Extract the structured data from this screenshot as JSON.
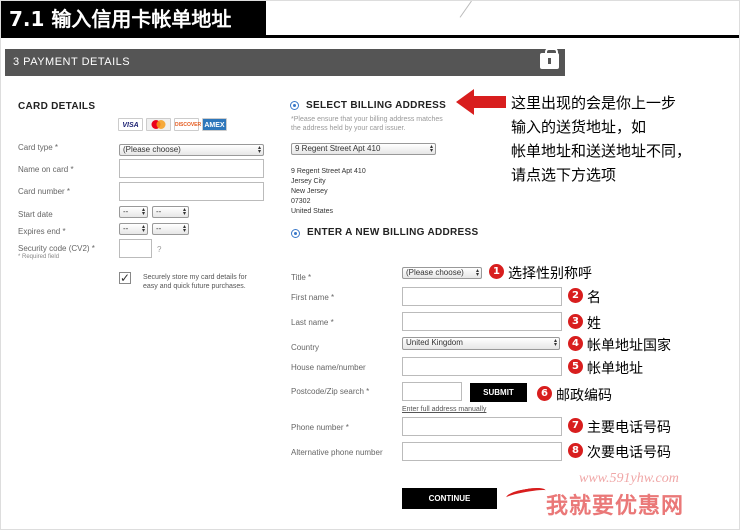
{
  "page": {
    "title": "7.1 输入信用卡帐单地址",
    "section": "3 PAYMENT DETAILS"
  },
  "card": {
    "heading": "CARD DETAILS",
    "logos": [
      "VISA",
      "MC",
      "DISCOVER",
      "AMEX"
    ],
    "type_label": "Card type *",
    "type_value": "(Please choose)",
    "name_label": "Name on card *",
    "number_label": "Card number *",
    "start_label": "Start date",
    "expires_label": "Expires end *",
    "date_placeholder": "--",
    "cv2_label": "Security code (CV2) *",
    "required_note": "* Required field",
    "cv2_help": "?",
    "store_text_1": "Securely store my card details for",
    "store_text_2": "easy and quick future purchases."
  },
  "billing": {
    "select_heading": "SELECT BILLING ADDRESS",
    "note_1": "*Please ensure that your billing address matches",
    "note_2": "the address held by your card issuer.",
    "address_select": "9 Regent Street Apt 410",
    "address_lines": [
      "9 Regent Street Apt 410",
      "Jersey City",
      "New Jersey",
      "07302",
      "United States"
    ],
    "new_heading": "ENTER A NEW BILLING ADDRESS"
  },
  "form": {
    "title_label": "Title *",
    "title_value": "(Please choose)",
    "first_label": "First name *",
    "last_label": "Last name *",
    "country_label": "Country",
    "country_value": "United Kingdom",
    "house_label": "House name/number",
    "postcode_label": "Postcode/Zip search *",
    "submit_label": "SUBMIT",
    "manual_link": "Enter full address manually",
    "phone_label": "Phone number *",
    "alt_phone_label": "Alternative phone number",
    "continue_label": "CONTINUE"
  },
  "annotations": {
    "big_note": [
      "这里出现的会是你上一步",
      "输入的送货地址，如",
      "帐单地址和送送地址不同，",
      "请点选下方选项"
    ],
    "items": [
      {
        "num": "1",
        "text": "选择性别称呼"
      },
      {
        "num": "2",
        "text": "名"
      },
      {
        "num": "3",
        "text": "姓"
      },
      {
        "num": "4",
        "text": "帐单地址国家"
      },
      {
        "num": "5",
        "text": "帐单地址"
      },
      {
        "num": "6",
        "text": "邮政编码"
      },
      {
        "num": "7",
        "text": "主要电话号码"
      },
      {
        "num": "8",
        "text": "次要电话号码"
      }
    ]
  },
  "watermark": {
    "url": "www.591yhw.com",
    "logo": "我就要优惠网"
  },
  "colors": {
    "accent_red": "#d81e1e",
    "section_bar": "#555555",
    "radio_blue": "#3a78c8"
  }
}
